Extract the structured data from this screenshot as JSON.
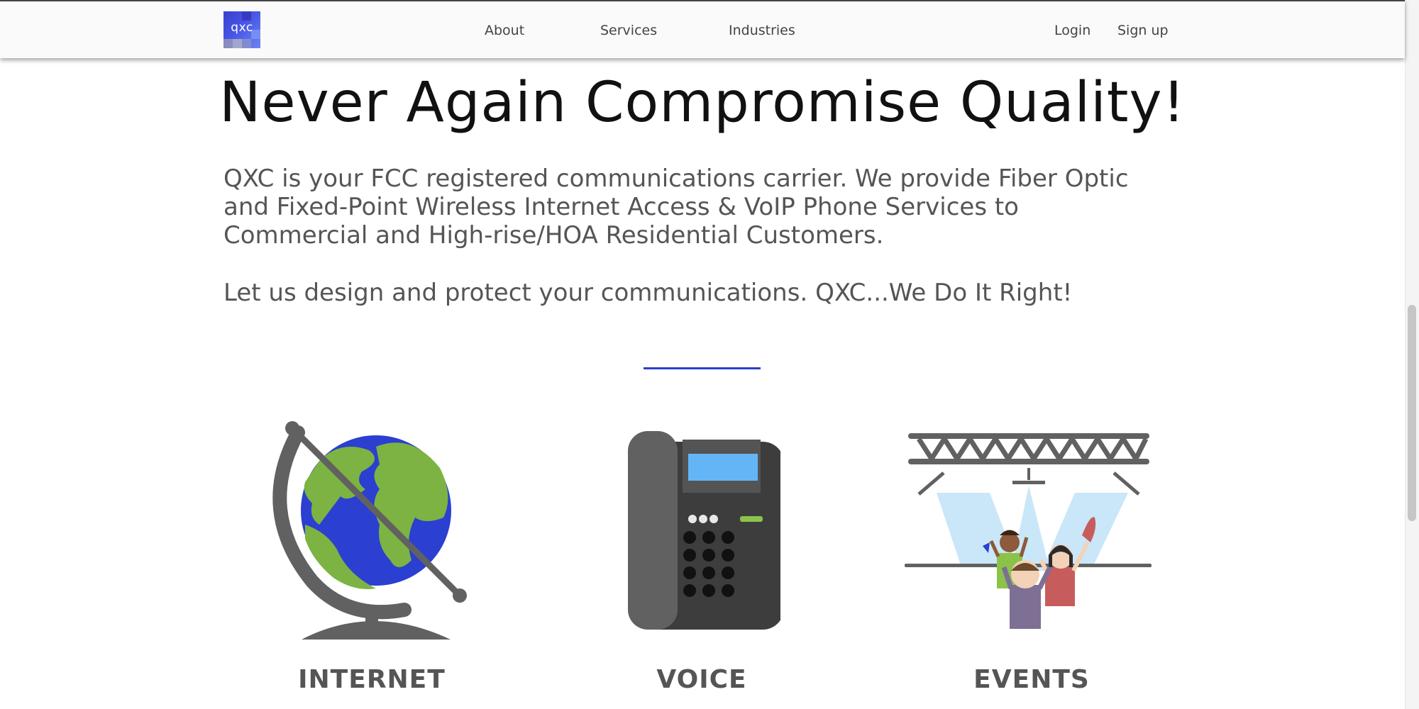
{
  "nav": {
    "logo_text": "qxc",
    "links": [
      "About",
      "Services",
      "Industries"
    ],
    "login": "Login",
    "signup": "Sign up"
  },
  "hero": {
    "headline": "Never Again Compromise Quality!",
    "paragraph1": "QXC is your FCC registered communications carrier. We provide Fiber Optic and Fixed-Point Wireless Internet Access & VoIP Phone Services to Commercial and High-rise/HOA Residential Customers.",
    "paragraph2": "Let us design and protect your communications. QXC...We Do It Right!"
  },
  "services": [
    {
      "label": "INTERNET",
      "icon": "globe-icon"
    },
    {
      "label": "VOICE",
      "icon": "desk-phone-icon"
    },
    {
      "label": "EVENTS",
      "icon": "stage-crowd-icon"
    }
  ],
  "colors": {
    "accent": "#2b3fd0",
    "globe_land": "#7cb342",
    "globe_water": "#2b3fd0",
    "icon_gray": "#616161",
    "phone_screen": "#64b5f6"
  }
}
